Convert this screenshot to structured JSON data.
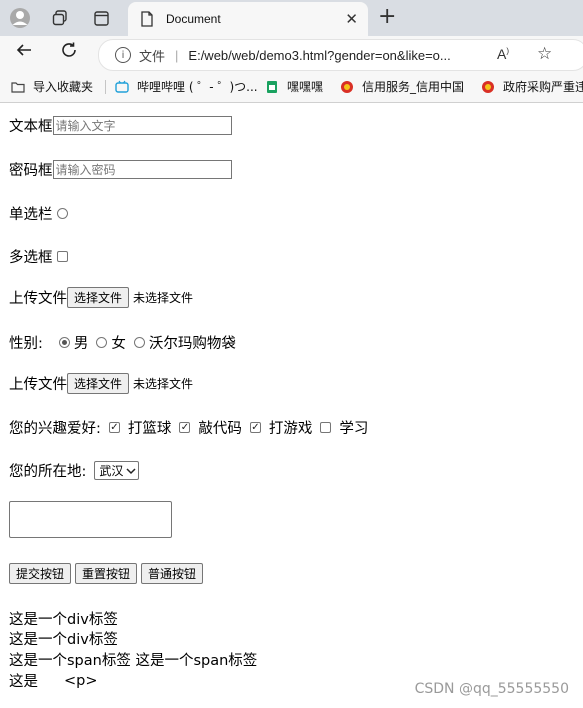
{
  "browser": {
    "tab_title": "Document",
    "address_scheme_label": "文件",
    "url": "E:/web/web/demo3.html?gender=on&like=o...",
    "bookmarks": [
      {
        "label": "导入收藏夹",
        "color": "#444444"
      },
      {
        "label": "哔哩哔哩 ( ゜- ゜)つ...",
        "color": "#20a0d8"
      },
      {
        "label": "嘿嘿嘿",
        "color": "#1aa260"
      },
      {
        "label": "信用服务_信用中国",
        "color": "#d93025"
      },
      {
        "label": "政府采购严重违",
        "color": "#d93025"
      }
    ]
  },
  "form": {
    "text_label": "文本框",
    "text_placeholder": "请输入文字",
    "password_label": "密码框",
    "password_placeholder": "请输入密码",
    "radio_label": "单选栏",
    "checkbox_label": "多选框",
    "upload_label": "上传文件",
    "upload_button": "选择文件",
    "upload_status": "未选择文件",
    "gender_label": "性别:",
    "gender_options": [
      {
        "label": "男",
        "checked": true
      },
      {
        "label": "女",
        "checked": false
      },
      {
        "label": "沃尔玛购物袋",
        "checked": false
      }
    ],
    "upload2_label": "上传文件",
    "upload2_button": "选择文件",
    "upload2_status": "未选择文件",
    "hobby_label": "您的兴趣爱好:",
    "hobbies": [
      {
        "label": "打篮球",
        "checked": true
      },
      {
        "label": "敲代码",
        "checked": true
      },
      {
        "label": "打游戏",
        "checked": true
      },
      {
        "label": "学习",
        "checked": false
      }
    ],
    "location_label": "您的所在地:",
    "location_selected": "武汉",
    "submit_button": "提交按钮",
    "reset_button": "重置按钮",
    "normal_button": "普通按钮"
  },
  "content": {
    "div1": "这是一个div标签",
    "div2": "这是一个div标签",
    "span_line": "这是一个span标签 这是一个span标签",
    "p_line_prefix": "这是",
    "p_line_tag": "<p>"
  },
  "watermark": "CSDN @qq_55555550"
}
